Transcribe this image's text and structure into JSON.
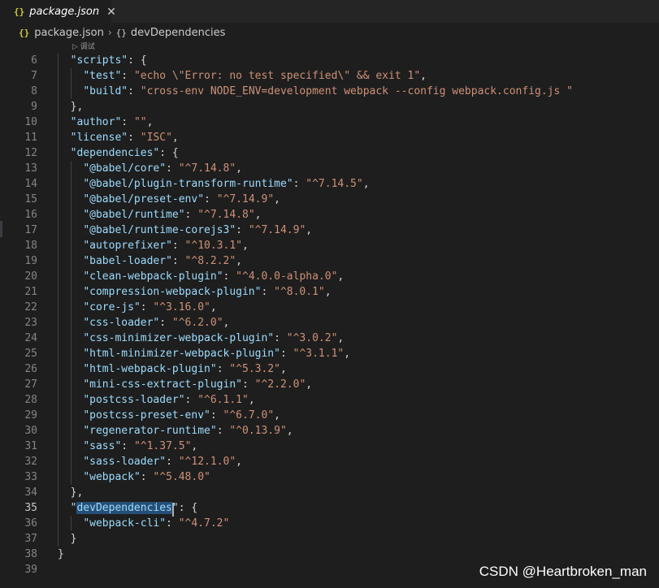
{
  "tab": {
    "label": "package.json",
    "icon": "{}",
    "close": "✕"
  },
  "breadcrumb": {
    "file": "package.json",
    "file_icon": "{}",
    "separator": "›",
    "symbol_icon": "{}",
    "symbol": "devDependencies"
  },
  "codelens": "▷ 调试",
  "watermark": "CSDN @Heartbroken_man",
  "colors": {
    "key": "#9cdcfe",
    "string": "#ce9178",
    "punct": "#d4d4d4",
    "selection": "#264f78"
  },
  "active_line": 35,
  "lines": [
    {
      "n": "6",
      "indent": "  ",
      "key": "scripts",
      "post": ": {"
    },
    {
      "n": "7",
      "indent": "    ",
      "key": "test",
      "post": ": ",
      "val": "echo \\\"Error: no test specified\\\" && exit 1",
      "tail": ","
    },
    {
      "n": "8",
      "indent": "    ",
      "key": "build",
      "post": ": ",
      "val": "cross-env NODE_ENV=development webpack --config webpack.config.js ",
      "tail": ""
    },
    {
      "n": "9",
      "indent": "  ",
      "raw": "},"
    },
    {
      "n": "10",
      "indent": "  ",
      "key": "author",
      "post": ": ",
      "val": "",
      "tail": ","
    },
    {
      "n": "11",
      "indent": "  ",
      "key": "license",
      "post": ": ",
      "val": "ISC",
      "tail": ","
    },
    {
      "n": "12",
      "indent": "  ",
      "key": "dependencies",
      "post": ": {"
    },
    {
      "n": "13",
      "indent": "    ",
      "key": "@babel/core",
      "post": ": ",
      "val": "^7.14.8",
      "tail": ","
    },
    {
      "n": "14",
      "indent": "    ",
      "key": "@babel/plugin-transform-runtime",
      "post": ": ",
      "val": "^7.14.5",
      "tail": ","
    },
    {
      "n": "15",
      "indent": "    ",
      "key": "@babel/preset-env",
      "post": ": ",
      "val": "^7.14.9",
      "tail": ","
    },
    {
      "n": "16",
      "indent": "    ",
      "key": "@babel/runtime",
      "post": ": ",
      "val": "^7.14.8",
      "tail": ","
    },
    {
      "n": "17",
      "indent": "    ",
      "key": "@babel/runtime-corejs3",
      "post": ": ",
      "val": "^7.14.9",
      "tail": ","
    },
    {
      "n": "18",
      "indent": "    ",
      "key": "autoprefixer",
      "post": ": ",
      "val": "^10.3.1",
      "tail": ","
    },
    {
      "n": "19",
      "indent": "    ",
      "key": "babel-loader",
      "post": ": ",
      "val": "^8.2.2",
      "tail": ","
    },
    {
      "n": "20",
      "indent": "    ",
      "key": "clean-webpack-plugin",
      "post": ": ",
      "val": "^4.0.0-alpha.0",
      "tail": ","
    },
    {
      "n": "21",
      "indent": "    ",
      "key": "compression-webpack-plugin",
      "post": ": ",
      "val": "^8.0.1",
      "tail": ","
    },
    {
      "n": "22",
      "indent": "    ",
      "key": "core-js",
      "post": ": ",
      "val": "^3.16.0",
      "tail": ","
    },
    {
      "n": "23",
      "indent": "    ",
      "key": "css-loader",
      "post": ": ",
      "val": "^6.2.0",
      "tail": ","
    },
    {
      "n": "24",
      "indent": "    ",
      "key": "css-minimizer-webpack-plugin",
      "post": ": ",
      "val": "^3.0.2",
      "tail": ","
    },
    {
      "n": "25",
      "indent": "    ",
      "key": "html-minimizer-webpack-plugin",
      "post": ": ",
      "val": "^3.1.1",
      "tail": ","
    },
    {
      "n": "26",
      "indent": "    ",
      "key": "html-webpack-plugin",
      "post": ": ",
      "val": "^5.3.2",
      "tail": ","
    },
    {
      "n": "27",
      "indent": "    ",
      "key": "mini-css-extract-plugin",
      "post": ": ",
      "val": "^2.2.0",
      "tail": ","
    },
    {
      "n": "28",
      "indent": "    ",
      "key": "postcss-loader",
      "post": ": ",
      "val": "^6.1.1",
      "tail": ","
    },
    {
      "n": "29",
      "indent": "    ",
      "key": "postcss-preset-env",
      "post": ": ",
      "val": "^6.7.0",
      "tail": ","
    },
    {
      "n": "30",
      "indent": "    ",
      "key": "regenerator-runtime",
      "post": ": ",
      "val": "^0.13.9",
      "tail": ","
    },
    {
      "n": "31",
      "indent": "    ",
      "key": "sass",
      "post": ": ",
      "val": "^1.37.5",
      "tail": ","
    },
    {
      "n": "32",
      "indent": "    ",
      "key": "sass-loader",
      "post": ": ",
      "val": "^12.1.0",
      "tail": ","
    },
    {
      "n": "33",
      "indent": "    ",
      "key": "webpack",
      "post": ": ",
      "val": "^5.48.0",
      "tail": ""
    },
    {
      "n": "34",
      "indent": "  ",
      "raw": "},"
    },
    {
      "n": "35",
      "indent": "  ",
      "key": "devDependencies",
      "post": ": {",
      "selected": true
    },
    {
      "n": "36",
      "indent": "    ",
      "key": "webpack-cli",
      "post": ": ",
      "val": "^4.7.2",
      "tail": ""
    },
    {
      "n": "37",
      "indent": "  ",
      "raw": "}"
    },
    {
      "n": "38",
      "indent": "",
      "raw": "}"
    },
    {
      "n": "39",
      "indent": "",
      "raw": ""
    }
  ]
}
